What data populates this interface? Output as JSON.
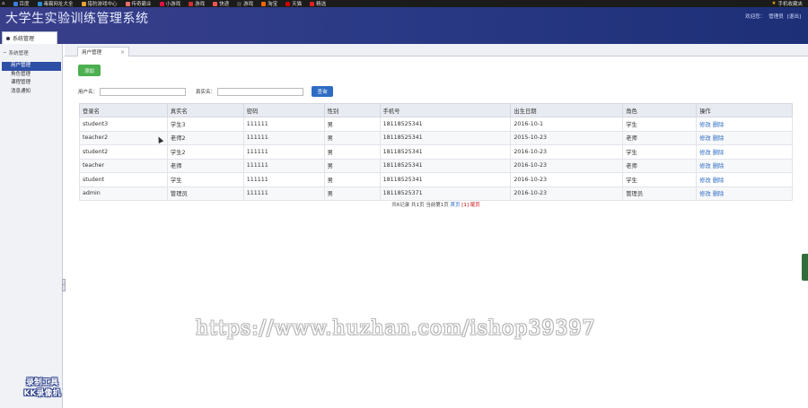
{
  "bookmarks": [
    "百度",
    "毒霸网址大全",
    "猎豹游戏中心",
    "传奇霸业",
    "小游戏",
    "游戏",
    "快递",
    "游戏",
    "淘宝",
    "天猫",
    "精选"
  ],
  "bookmark_right": "手机收藏夹",
  "header": {
    "title": "大学生实验训练管理系统",
    "welcome": "欢迎您：",
    "user": "管理员",
    "logout": "[退出]"
  },
  "sidebar": {
    "panel_title": "系统管理",
    "group": "系统管理",
    "items": [
      {
        "label": "用户管理",
        "active": true
      },
      {
        "label": "角色管理",
        "active": false
      },
      {
        "label": "课程管理",
        "active": false
      },
      {
        "label": "消息通知",
        "active": false
      }
    ]
  },
  "tab": {
    "label": "用户管理",
    "close": "×"
  },
  "toolbar": {
    "add_label": "添加"
  },
  "search": {
    "username_label": "用户名：",
    "username_value": "",
    "realname_label": "真实名：",
    "realname_value": "",
    "query_label": "查询"
  },
  "table": {
    "columns": [
      "登录名",
      "真实名",
      "密码",
      "性别",
      "手机号",
      "出生日期",
      "角色",
      "操作"
    ],
    "rows": [
      [
        "student3",
        "学生3",
        "111111",
        "男",
        "18118525341",
        "2016-10-1",
        "学生"
      ],
      [
        "teacher2",
        "老师2",
        "111111",
        "男",
        "18118525341",
        "2015-10-23",
        "老师"
      ],
      [
        "student2",
        "学生2",
        "111111",
        "男",
        "18118525341",
        "2016-10-23",
        "学生"
      ],
      [
        "teacher",
        "老师",
        "111111",
        "男",
        "18118525341",
        "2016-10-23",
        "老师"
      ],
      [
        "student",
        "学生",
        "111111",
        "男",
        "18118525341",
        "2016-10-23",
        "学生"
      ],
      [
        "admin",
        "管理员",
        "111111",
        "男",
        "18118525371",
        "2016-10-23",
        "管理员"
      ]
    ],
    "edit_label": "修改",
    "delete_label": "删除"
  },
  "pager": {
    "summary": "共6记录 共1页 当前第1页",
    "first": "首页",
    "current": "[1]",
    "last": "尾页"
  },
  "logo": {
    "line1": "录制工具",
    "line2": "KK录像机"
  },
  "watermark": "https://www.huzhan.com/ishop39397",
  "colors": {
    "header": "#2b3a86",
    "active": "#2e4fa6",
    "add": "#4caf50",
    "query": "#2e6cc4"
  }
}
